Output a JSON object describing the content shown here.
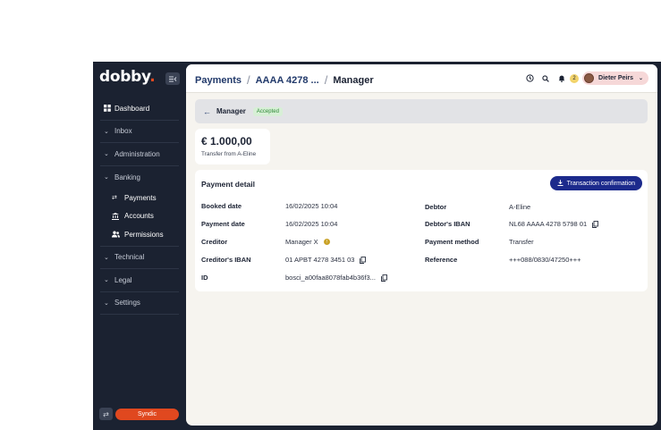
{
  "sidebar": {
    "logo": "dobby",
    "logo_dot": ".",
    "items": [
      {
        "label": "Dashboard",
        "icon": "dashboard-icon"
      },
      {
        "label": "Inbox",
        "icon": "chevron-down-icon"
      },
      {
        "label": "Administration",
        "icon": "chevron-down-icon"
      },
      {
        "label": "Banking",
        "icon": "chevron-down-icon"
      },
      {
        "label": "Technical",
        "icon": "chevron-down-icon"
      },
      {
        "label": "Legal",
        "icon": "chevron-down-icon"
      },
      {
        "label": "Settings",
        "icon": "chevron-down-icon"
      }
    ],
    "banking_sub": [
      {
        "label": "Payments",
        "icon": "transfer-icon"
      },
      {
        "label": "Accounts",
        "icon": "bank-icon"
      },
      {
        "label": "Permissions",
        "icon": "users-icon"
      }
    ],
    "syndic_label": "Syndic"
  },
  "topbar": {
    "crumbs": [
      "Payments",
      "AAAA 4278 ...",
      "Manager"
    ],
    "notification_count": "2",
    "user_name": "Dieter Peirs"
  },
  "header": {
    "title": "Manager",
    "status": "Accepted",
    "status_color": "#2f8a37"
  },
  "amount": {
    "value": "€ 1.000,00",
    "subtitle": "Transfer from A-Eline"
  },
  "detail": {
    "title": "Payment detail",
    "button_label": "Transaction confirmation",
    "left": [
      {
        "label": "Booked date",
        "value": "16/02/2025 10:04"
      },
      {
        "label": "Payment date",
        "value": "16/02/2025 10:04"
      },
      {
        "label": "Creditor",
        "value": "Manager X"
      },
      {
        "label": "Creditor's IBAN",
        "value": "01 APBT 4278 3451 03"
      },
      {
        "label": "ID",
        "value": "bosci_a00faa8078fab4b36f3..."
      }
    ],
    "right": [
      {
        "label": "Debtor",
        "value": "A-Eline"
      },
      {
        "label": "Debtor's IBAN",
        "value": "NL68 AAAA 4278 5798 01"
      },
      {
        "label": "Payment method",
        "value": "Transfer"
      },
      {
        "label": "Reference",
        "value": "+++088/0830/47250+++"
      }
    ]
  },
  "colors": {
    "sidebar_bg": "#1b2231",
    "accent": "#e0481f",
    "primary_button": "#1c2a8c"
  }
}
